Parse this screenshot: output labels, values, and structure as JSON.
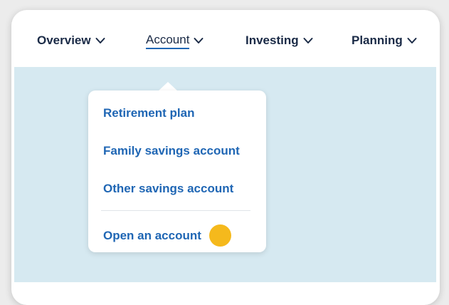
{
  "nav": {
    "items": [
      {
        "label": "Overview"
      },
      {
        "label": "Account"
      },
      {
        "label": "Investing"
      },
      {
        "label": "Planning"
      }
    ],
    "active_index": 1
  },
  "dropdown": {
    "items": [
      {
        "label": "Retirement plan"
      },
      {
        "label": "Family savings account"
      },
      {
        "label": "Other savings account"
      }
    ],
    "footer_item": {
      "label": "Open an account"
    }
  },
  "colors": {
    "nav_text": "#1a2a46",
    "link": "#1f66b4",
    "panel_bg": "#d6e9f1",
    "dot": "#f5b91c"
  }
}
